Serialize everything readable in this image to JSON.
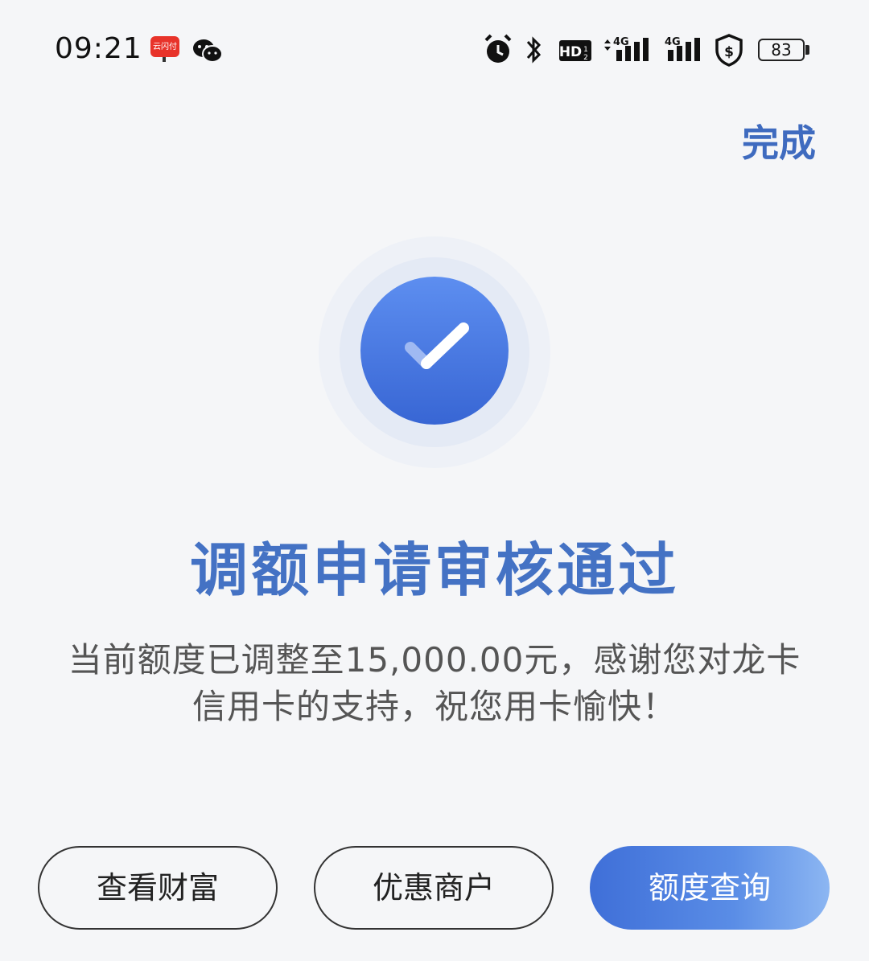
{
  "status_bar": {
    "time": "09:21",
    "unionpay_icon_text": "云闪付",
    "battery": "83",
    "icons": [
      "unionpay-app-icon",
      "wechat-icon",
      "alarm-icon",
      "bluetooth-icon",
      "hd-icon",
      "signal-4g-icon",
      "signal-4g-icon",
      "shield-dollar-icon",
      "battery-icon"
    ]
  },
  "header": {
    "done_label": "完成"
  },
  "result": {
    "icon": "check-icon",
    "title": "调额申请审核通过",
    "message": "当前额度已调整至15,000.00元，感谢您对龙卡信用卡的支持，祝您用卡愉快！"
  },
  "actions": {
    "wealth_label": "查看财富",
    "merchants_label": "优惠商户",
    "limit_query_label": "额度查询"
  },
  "colors": {
    "accent": "#4472c4",
    "background": "#f5f6f8"
  }
}
